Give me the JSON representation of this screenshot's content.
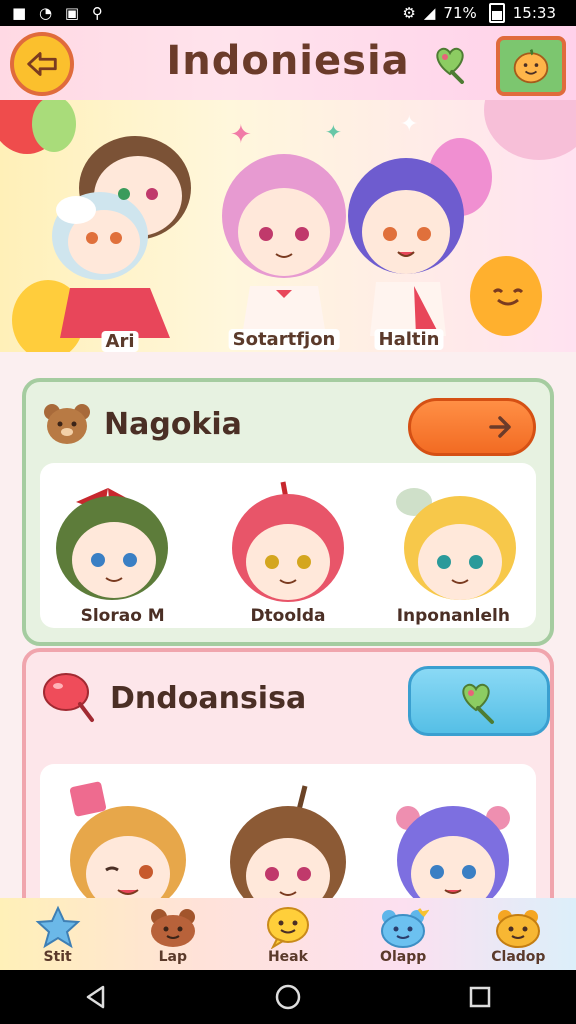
{
  "status_bar": {
    "time": "15:33",
    "battery": "71%"
  },
  "header": {
    "title": "Indoniesia"
  },
  "banner": {
    "characters": [
      {
        "name": "Ari"
      },
      {
        "name": "Sotartfjon"
      },
      {
        "name": "Haltin"
      }
    ]
  },
  "sections": [
    {
      "title": "Nagokia",
      "cards": [
        {
          "label": "Slorao M"
        },
        {
          "label": "Dtoolda"
        },
        {
          "label": "Inponanlelh"
        }
      ]
    },
    {
      "title": "Dndoansisa",
      "cards": [
        {
          "label": ""
        },
        {
          "label": ""
        },
        {
          "label": ""
        }
      ]
    }
  ],
  "tabs": [
    {
      "label": "Stit"
    },
    {
      "label": "Lap"
    },
    {
      "label": "Heak"
    },
    {
      "label": "Olapp"
    },
    {
      "label": "Cladop"
    }
  ],
  "colors": {
    "accent_orange": "#f26b23",
    "accent_blue": "#55bfe6",
    "title_brown": "#6b3b2a"
  }
}
